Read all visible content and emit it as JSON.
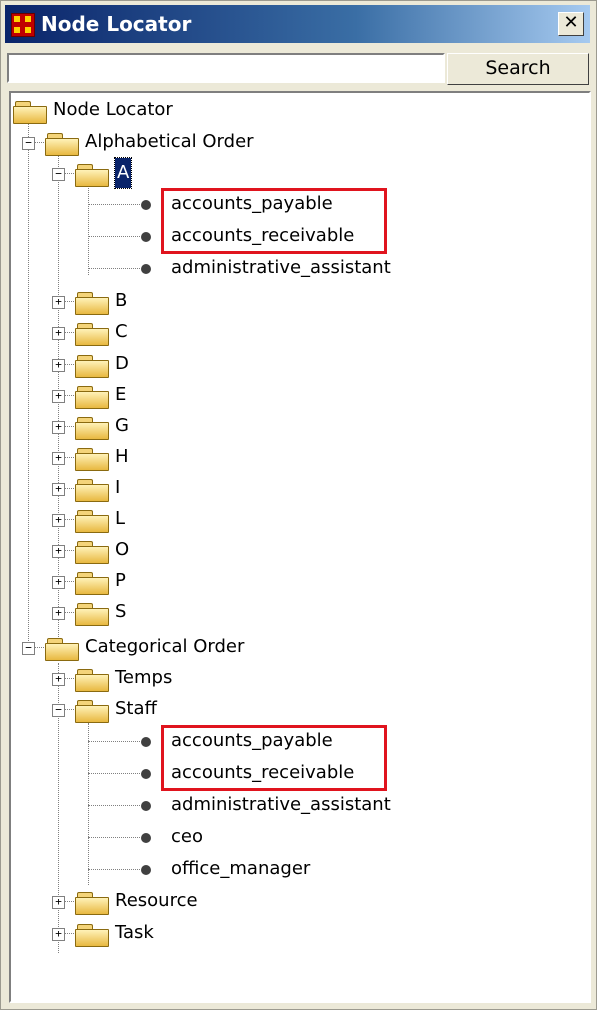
{
  "window": {
    "title": "Node Locator",
    "close_glyph": "✕"
  },
  "search": {
    "value": "",
    "placeholder": "",
    "button_label": "Search"
  },
  "tree": {
    "root_label": "Node Locator",
    "alphabetical": {
      "label": "Alphabetical Order",
      "open_folder": "A",
      "a_items": [
        "accounts_payable",
        "accounts_receivable",
        "administrative_assistant"
      ],
      "collapsed": [
        "B",
        "C",
        "D",
        "E",
        "G",
        "H",
        "I",
        "L",
        "O",
        "P",
        "S"
      ]
    },
    "categorical": {
      "label": "Categorical Order",
      "temps": "Temps",
      "staff": "Staff",
      "staff_items": [
        "accounts_payable",
        "accounts_receivable",
        "administrative_assistant",
        "ceo",
        "office_manager"
      ],
      "resource": "Resource",
      "task": "Task"
    }
  },
  "colors": {
    "title_bar": "#0a246a",
    "highlight": "#e0141e",
    "selection": "#0a246a"
  },
  "icons": {
    "folder": "folder-icon",
    "leaf": "node-dot-icon",
    "expand": "plus-icon",
    "collapse": "minus-icon",
    "app": "app-grid-icon",
    "close": "close-icon"
  }
}
